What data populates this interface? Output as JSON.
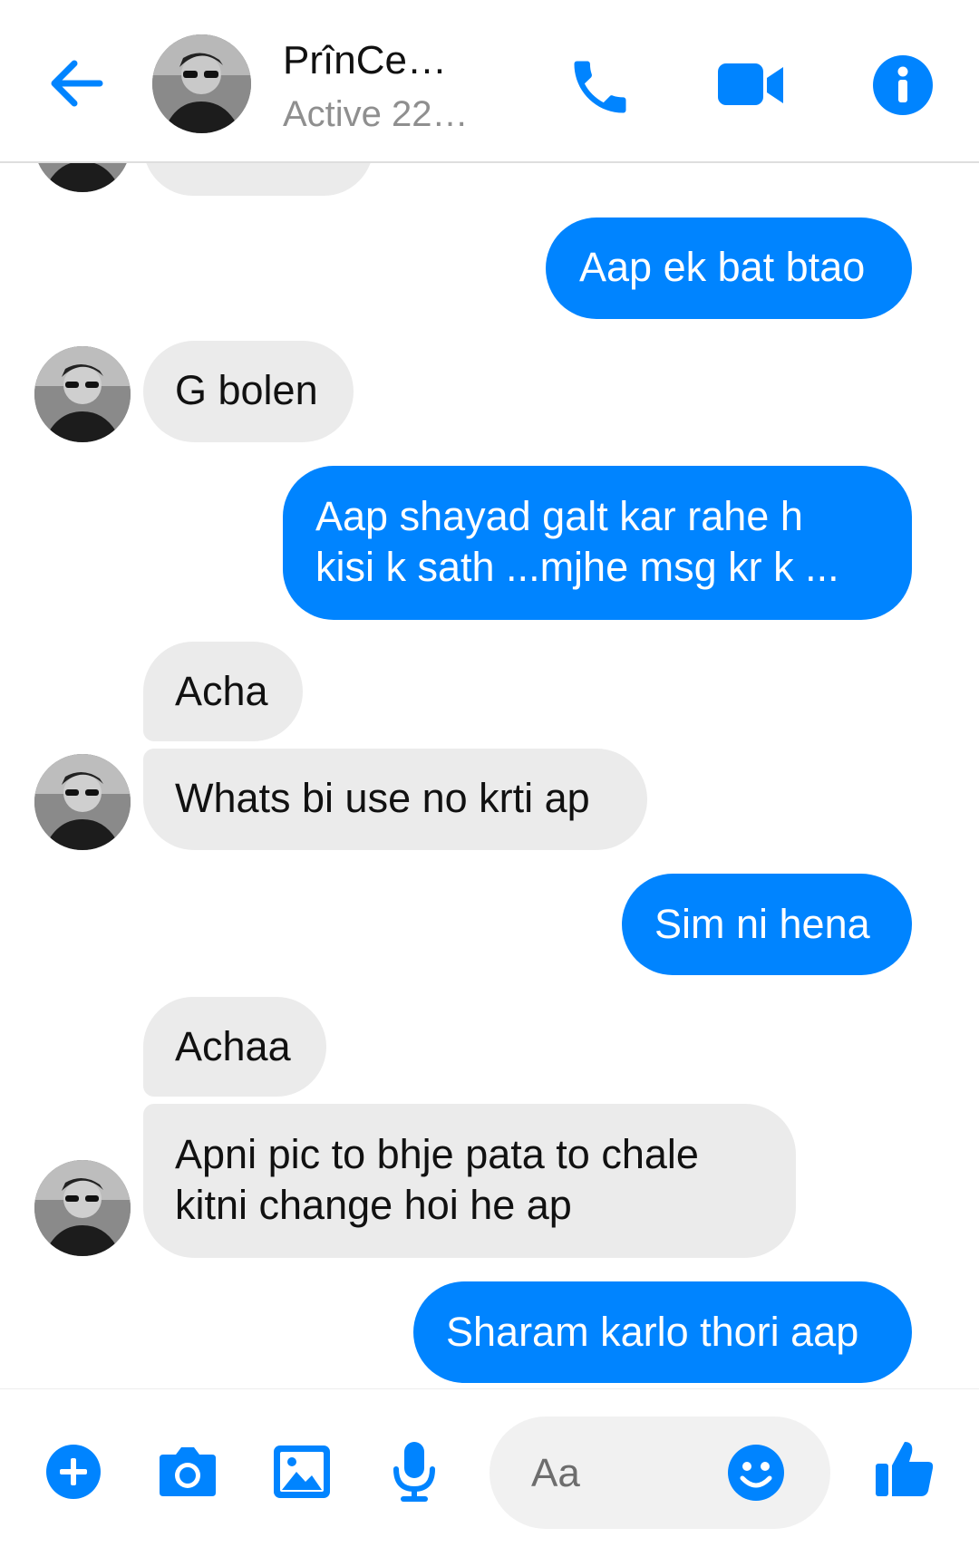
{
  "header": {
    "contact_name": "PrînCe…",
    "status": "Active 22…",
    "icons": [
      "back-arrow-icon",
      "phone-icon",
      "video-camera-icon",
      "info-icon"
    ]
  },
  "messages": [
    {
      "id": "m0",
      "dir": "in",
      "text": ""
    },
    {
      "id": "m1",
      "dir": "out",
      "text": "Aap ek bat btao"
    },
    {
      "id": "m2",
      "dir": "in",
      "text": "G bolen"
    },
    {
      "id": "m3",
      "dir": "out",
      "line1": "Aap shayad galt kar rahe h",
      "line2": "kisi k sath ...mjhe msg kr k ..."
    },
    {
      "id": "m4",
      "dir": "in",
      "text": "Acha"
    },
    {
      "id": "m5",
      "dir": "in",
      "text": "Whats bi use no krti ap"
    },
    {
      "id": "m6",
      "dir": "out",
      "text": "Sim ni hena"
    },
    {
      "id": "m7",
      "dir": "in",
      "text": "Achaa"
    },
    {
      "id": "m8",
      "dir": "in",
      "line1": "Apni pic to bhje pata to chale",
      "line2": "kitni change hoi he ap"
    },
    {
      "id": "m9",
      "dir": "out",
      "text": "Sharam karlo thori aap"
    }
  ],
  "composer": {
    "placeholder": "Aa",
    "icons": [
      "plus-icon",
      "camera-icon",
      "image-icon",
      "microphone-icon",
      "emoji-icon",
      "thumbs-up-icon"
    ]
  },
  "colors": {
    "accent": "#0084ff",
    "incoming_bubble": "#ebebeb",
    "outgoing_text": "#ffffff",
    "status_text": "#8f8f8f"
  }
}
